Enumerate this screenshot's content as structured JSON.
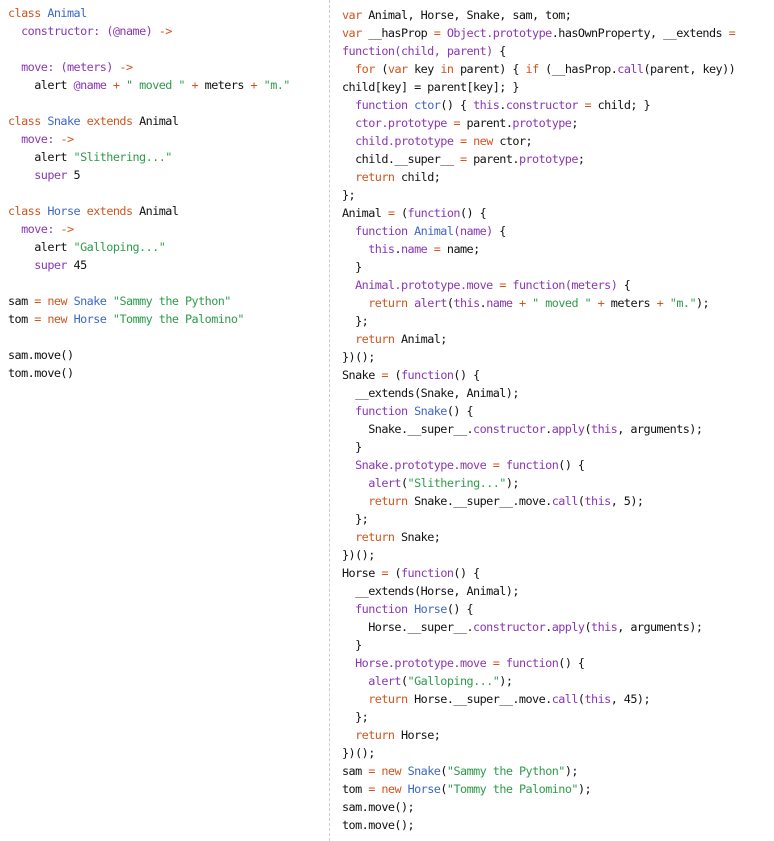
{
  "colors": {
    "keyword": "#d2541d",
    "classname": "#3d66c8",
    "string": "#2f9b4b",
    "fn": "#8a37b3",
    "plain": "#111111"
  },
  "left_pane": {
    "lines": [
      [
        [
          "k",
          "class"
        ],
        [
          "p",
          " "
        ],
        [
          "c",
          "Animal"
        ]
      ],
      [
        [
          "p",
          "  "
        ],
        [
          "f",
          "constructor:"
        ],
        [
          "p",
          " "
        ],
        [
          "f",
          "(@name)"
        ],
        [
          "p",
          " "
        ],
        [
          "k",
          "->"
        ]
      ],
      [],
      [
        [
          "p",
          "  "
        ],
        [
          "f",
          "move:"
        ],
        [
          "p",
          " "
        ],
        [
          "f",
          "(meters)"
        ],
        [
          "p",
          " "
        ],
        [
          "k",
          "->"
        ]
      ],
      [
        [
          "p",
          "    alert "
        ],
        [
          "f",
          "@name"
        ],
        [
          "p",
          " "
        ],
        [
          "k",
          "+"
        ],
        [
          "p",
          " "
        ],
        [
          "s",
          "\" moved \""
        ],
        [
          "p",
          " "
        ],
        [
          "k",
          "+"
        ],
        [
          "p",
          " meters "
        ],
        [
          "k",
          "+"
        ],
        [
          "p",
          " "
        ],
        [
          "s",
          "\"m.\""
        ]
      ],
      [],
      [
        [
          "k",
          "class"
        ],
        [
          "p",
          " "
        ],
        [
          "c",
          "Snake"
        ],
        [
          "p",
          " "
        ],
        [
          "k",
          "extends"
        ],
        [
          "p",
          " Animal"
        ]
      ],
      [
        [
          "p",
          "  "
        ],
        [
          "f",
          "move:"
        ],
        [
          "p",
          " "
        ],
        [
          "k",
          "->"
        ]
      ],
      [
        [
          "p",
          "    alert "
        ],
        [
          "s",
          "\"Slithering...\""
        ]
      ],
      [
        [
          "p",
          "    "
        ],
        [
          "f",
          "super"
        ],
        [
          "p",
          " 5"
        ]
      ],
      [],
      [
        [
          "k",
          "class"
        ],
        [
          "p",
          " "
        ],
        [
          "c",
          "Horse"
        ],
        [
          "p",
          " "
        ],
        [
          "k",
          "extends"
        ],
        [
          "p",
          " Animal"
        ]
      ],
      [
        [
          "p",
          "  "
        ],
        [
          "f",
          "move:"
        ],
        [
          "p",
          " "
        ],
        [
          "k",
          "->"
        ]
      ],
      [
        [
          "p",
          "    alert "
        ],
        [
          "s",
          "\"Galloping...\""
        ]
      ],
      [
        [
          "p",
          "    "
        ],
        [
          "f",
          "super"
        ],
        [
          "p",
          " 45"
        ]
      ],
      [],
      [
        [
          "p",
          "sam "
        ],
        [
          "k",
          "="
        ],
        [
          "p",
          " "
        ],
        [
          "k",
          "new"
        ],
        [
          "p",
          " "
        ],
        [
          "c",
          "Snake"
        ],
        [
          "p",
          " "
        ],
        [
          "s",
          "\"Sammy the Python\""
        ]
      ],
      [
        [
          "p",
          "tom "
        ],
        [
          "k",
          "="
        ],
        [
          "p",
          " "
        ],
        [
          "k",
          "new"
        ],
        [
          "p",
          " "
        ],
        [
          "c",
          "Horse"
        ],
        [
          "p",
          " "
        ],
        [
          "s",
          "\"Tommy the Palomino\""
        ]
      ],
      [],
      [
        [
          "p",
          "sam.move()"
        ]
      ],
      [
        [
          "p",
          "tom.move()"
        ]
      ]
    ]
  },
  "right_pane": {
    "lines": [
      [
        [
          "k",
          "var"
        ],
        [
          "p",
          " Animal, Horse, Snake, sam, tom;"
        ]
      ],
      [
        [
          "k",
          "var"
        ],
        [
          "p",
          " __hasProp "
        ],
        [
          "k",
          "="
        ],
        [
          "p",
          " "
        ],
        [
          "f",
          "Object.prototype"
        ],
        [
          "p",
          ".hasOwnProperty, __extends "
        ],
        [
          "k",
          "="
        ]
      ],
      [
        [
          "f",
          "function(child, parent)"
        ],
        [
          "p",
          " {"
        ]
      ],
      [
        [
          "p",
          "  "
        ],
        [
          "k",
          "for"
        ],
        [
          "p",
          " ("
        ],
        [
          "k",
          "var"
        ],
        [
          "p",
          " key "
        ],
        [
          "k",
          "in"
        ],
        [
          "p",
          " parent) { "
        ],
        [
          "k",
          "if"
        ],
        [
          "p",
          " (__hasProp."
        ],
        [
          "f",
          "call"
        ],
        [
          "p",
          "(parent, key))"
        ]
      ],
      [
        [
          "p",
          "child[key] = parent[key]; }"
        ]
      ],
      [
        [
          "p",
          "  "
        ],
        [
          "f",
          "function"
        ],
        [
          "p",
          " "
        ],
        [
          "c",
          "ctor"
        ],
        [
          "p",
          "() { "
        ],
        [
          "f",
          "this"
        ],
        [
          "p",
          "."
        ],
        [
          "f",
          "constructor"
        ],
        [
          "p",
          " "
        ],
        [
          "k",
          "="
        ],
        [
          "p",
          " child; }"
        ]
      ],
      [
        [
          "p",
          "  "
        ],
        [
          "f",
          "ctor.prototype"
        ],
        [
          "p",
          " "
        ],
        [
          "k",
          "="
        ],
        [
          "p",
          " parent."
        ],
        [
          "f",
          "prototype"
        ],
        [
          "p",
          ";"
        ]
      ],
      [
        [
          "p",
          "  "
        ],
        [
          "f",
          "child.prototype"
        ],
        [
          "p",
          " "
        ],
        [
          "k",
          "="
        ],
        [
          "p",
          " "
        ],
        [
          "k",
          "new"
        ],
        [
          "p",
          " ctor;"
        ]
      ],
      [
        [
          "p",
          "  child.__super__ "
        ],
        [
          "k",
          "="
        ],
        [
          "p",
          " parent."
        ],
        [
          "f",
          "prototype"
        ],
        [
          "p",
          ";"
        ]
      ],
      [
        [
          "p",
          "  "
        ],
        [
          "k",
          "return"
        ],
        [
          "p",
          " child;"
        ]
      ],
      [
        [
          "p",
          "};"
        ]
      ],
      [
        [
          "p",
          "Animal "
        ],
        [
          "k",
          "="
        ],
        [
          "p",
          " ("
        ],
        [
          "f",
          "function"
        ],
        [
          "p",
          "() {"
        ]
      ],
      [
        [
          "p",
          "  "
        ],
        [
          "f",
          "function"
        ],
        [
          "p",
          " "
        ],
        [
          "c",
          "Animal"
        ],
        [
          "f",
          "(name)"
        ],
        [
          "p",
          " {"
        ]
      ],
      [
        [
          "p",
          "    "
        ],
        [
          "f",
          "this"
        ],
        [
          "p",
          "."
        ],
        [
          "f",
          "name"
        ],
        [
          "p",
          " "
        ],
        [
          "k",
          "="
        ],
        [
          "p",
          " name;"
        ]
      ],
      [
        [
          "p",
          "  }"
        ]
      ],
      [
        [
          "p",
          "  "
        ],
        [
          "f",
          "Animal.prototype.move"
        ],
        [
          "p",
          " "
        ],
        [
          "k",
          "="
        ],
        [
          "p",
          " "
        ],
        [
          "f",
          "function(meters)"
        ],
        [
          "p",
          " {"
        ]
      ],
      [
        [
          "p",
          "    "
        ],
        [
          "k",
          "return"
        ],
        [
          "p",
          " "
        ],
        [
          "f",
          "alert"
        ],
        [
          "p",
          "("
        ],
        [
          "f",
          "this"
        ],
        [
          "p",
          "."
        ],
        [
          "f",
          "name"
        ],
        [
          "p",
          " "
        ],
        [
          "k",
          "+"
        ],
        [
          "p",
          " "
        ],
        [
          "s",
          "\" moved \""
        ],
        [
          "p",
          " "
        ],
        [
          "k",
          "+"
        ],
        [
          "p",
          " meters "
        ],
        [
          "k",
          "+"
        ],
        [
          "p",
          " "
        ],
        [
          "s",
          "\"m.\""
        ],
        [
          "p",
          ");"
        ]
      ],
      [
        [
          "p",
          "  };"
        ]
      ],
      [
        [
          "p",
          "  "
        ],
        [
          "k",
          "return"
        ],
        [
          "p",
          " Animal;"
        ]
      ],
      [
        [
          "p",
          "})();"
        ]
      ],
      [
        [
          "p",
          "Snake "
        ],
        [
          "k",
          "="
        ],
        [
          "p",
          " ("
        ],
        [
          "f",
          "function"
        ],
        [
          "p",
          "() {"
        ]
      ],
      [
        [
          "p",
          "  __extends(Snake, Animal);"
        ]
      ],
      [
        [
          "p",
          "  "
        ],
        [
          "f",
          "function"
        ],
        [
          "p",
          " "
        ],
        [
          "c",
          "Snake"
        ],
        [
          "p",
          "() {"
        ]
      ],
      [
        [
          "p",
          "    Snake.__super__."
        ],
        [
          "f",
          "constructor"
        ],
        [
          "p",
          "."
        ],
        [
          "f",
          "apply"
        ],
        [
          "p",
          "("
        ],
        [
          "f",
          "this"
        ],
        [
          "p",
          ", arguments);"
        ]
      ],
      [
        [
          "p",
          "  }"
        ]
      ],
      [
        [
          "p",
          "  "
        ],
        [
          "f",
          "Snake.prototype.move"
        ],
        [
          "p",
          " "
        ],
        [
          "k",
          "="
        ],
        [
          "p",
          " "
        ],
        [
          "f",
          "function"
        ],
        [
          "p",
          "() {"
        ]
      ],
      [
        [
          "p",
          "    "
        ],
        [
          "f",
          "alert"
        ],
        [
          "p",
          "("
        ],
        [
          "s",
          "\"Slithering...\""
        ],
        [
          "p",
          ");"
        ]
      ],
      [
        [
          "p",
          "    "
        ],
        [
          "k",
          "return"
        ],
        [
          "p",
          " Snake.__super__.move."
        ],
        [
          "f",
          "call"
        ],
        [
          "p",
          "("
        ],
        [
          "f",
          "this"
        ],
        [
          "p",
          ", 5);"
        ]
      ],
      [
        [
          "p",
          "  };"
        ]
      ],
      [
        [
          "p",
          "  "
        ],
        [
          "k",
          "return"
        ],
        [
          "p",
          " Snake;"
        ]
      ],
      [
        [
          "p",
          "})();"
        ]
      ],
      [
        [
          "p",
          "Horse "
        ],
        [
          "k",
          "="
        ],
        [
          "p",
          " ("
        ],
        [
          "f",
          "function"
        ],
        [
          "p",
          "() {"
        ]
      ],
      [
        [
          "p",
          "  __extends(Horse, Animal);"
        ]
      ],
      [
        [
          "p",
          "  "
        ],
        [
          "f",
          "function"
        ],
        [
          "p",
          " "
        ],
        [
          "c",
          "Horse"
        ],
        [
          "p",
          "() {"
        ]
      ],
      [
        [
          "p",
          "    Horse.__super__."
        ],
        [
          "f",
          "constructor"
        ],
        [
          "p",
          "."
        ],
        [
          "f",
          "apply"
        ],
        [
          "p",
          "("
        ],
        [
          "f",
          "this"
        ],
        [
          "p",
          ", arguments);"
        ]
      ],
      [
        [
          "p",
          "  }"
        ]
      ],
      [
        [
          "p",
          "  "
        ],
        [
          "f",
          "Horse.prototype.move"
        ],
        [
          "p",
          " "
        ],
        [
          "k",
          "="
        ],
        [
          "p",
          " "
        ],
        [
          "f",
          "function"
        ],
        [
          "p",
          "() {"
        ]
      ],
      [
        [
          "p",
          "    "
        ],
        [
          "f",
          "alert"
        ],
        [
          "p",
          "("
        ],
        [
          "s",
          "\"Galloping...\""
        ],
        [
          "p",
          ");"
        ]
      ],
      [
        [
          "p",
          "    "
        ],
        [
          "k",
          "return"
        ],
        [
          "p",
          " Horse.__super__.move."
        ],
        [
          "f",
          "call"
        ],
        [
          "p",
          "("
        ],
        [
          "f",
          "this"
        ],
        [
          "p",
          ", 45);"
        ]
      ],
      [
        [
          "p",
          "  };"
        ]
      ],
      [
        [
          "p",
          "  "
        ],
        [
          "k",
          "return"
        ],
        [
          "p",
          " Horse;"
        ]
      ],
      [
        [
          "p",
          "})();"
        ]
      ],
      [
        [
          "p",
          "sam "
        ],
        [
          "k",
          "="
        ],
        [
          "p",
          " "
        ],
        [
          "k",
          "new"
        ],
        [
          "p",
          " "
        ],
        [
          "c",
          "Snake"
        ],
        [
          "p",
          "("
        ],
        [
          "s",
          "\"Sammy the Python\""
        ],
        [
          "p",
          ");"
        ]
      ],
      [
        [
          "p",
          "tom "
        ],
        [
          "k",
          "="
        ],
        [
          "p",
          " "
        ],
        [
          "k",
          "new"
        ],
        [
          "p",
          " "
        ],
        [
          "c",
          "Horse"
        ],
        [
          "p",
          "("
        ],
        [
          "s",
          "\"Tommy the Palomino\""
        ],
        [
          "p",
          ");"
        ]
      ],
      [
        [
          "p",
          "sam.move();"
        ]
      ],
      [
        [
          "p",
          "tom.move();"
        ]
      ]
    ]
  }
}
